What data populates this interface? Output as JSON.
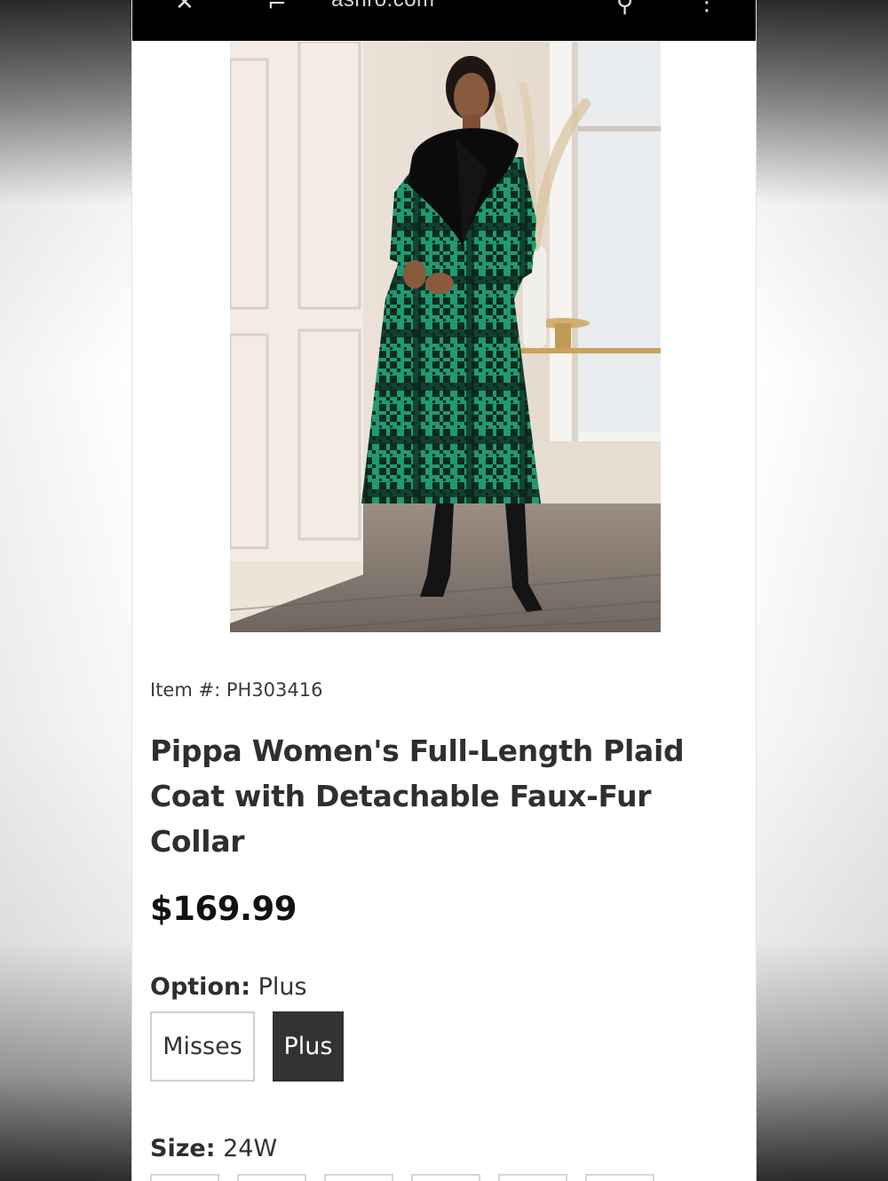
{
  "browser": {
    "url": "ashro.com"
  },
  "icons": {
    "close": "close-icon",
    "search": "search-icon",
    "more": "more-vertical-icon"
  },
  "product": {
    "item_label": "Item #: PH303416",
    "title": "Pippa Women's Full-Length Plaid Coat with Detachable Faux-Fur Collar",
    "price": "$169.99",
    "colors": {
      "coat_green": "#1f9a72",
      "coat_dark": "#0e1f17",
      "fur": "#0b0b0b"
    }
  },
  "option": {
    "label": "Option:",
    "selected": "Plus",
    "choices": [
      "Misses",
      "Plus"
    ]
  },
  "size": {
    "label": "Size:",
    "selected": "24W"
  }
}
